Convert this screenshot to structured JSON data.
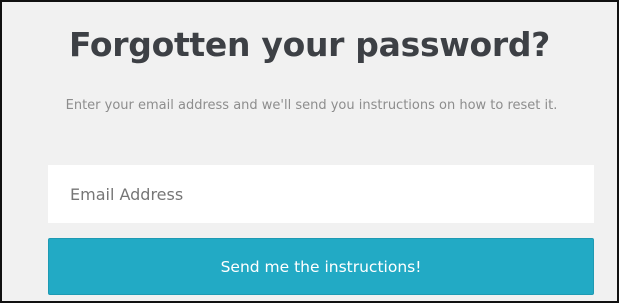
{
  "form": {
    "title": "Forgotten your password?",
    "subtitle": "Enter your email address and we'll send you instructions on how to reset it.",
    "email_placeholder": "Email Address",
    "email_value": "",
    "submit_label": "Send me the instructions!"
  },
  "colors": {
    "background": "#f1f1f1",
    "title": "#3d4045",
    "subtitle": "#8d8d8d",
    "button": "#22aac5",
    "button_text": "#ffffff",
    "border": "#111111"
  }
}
